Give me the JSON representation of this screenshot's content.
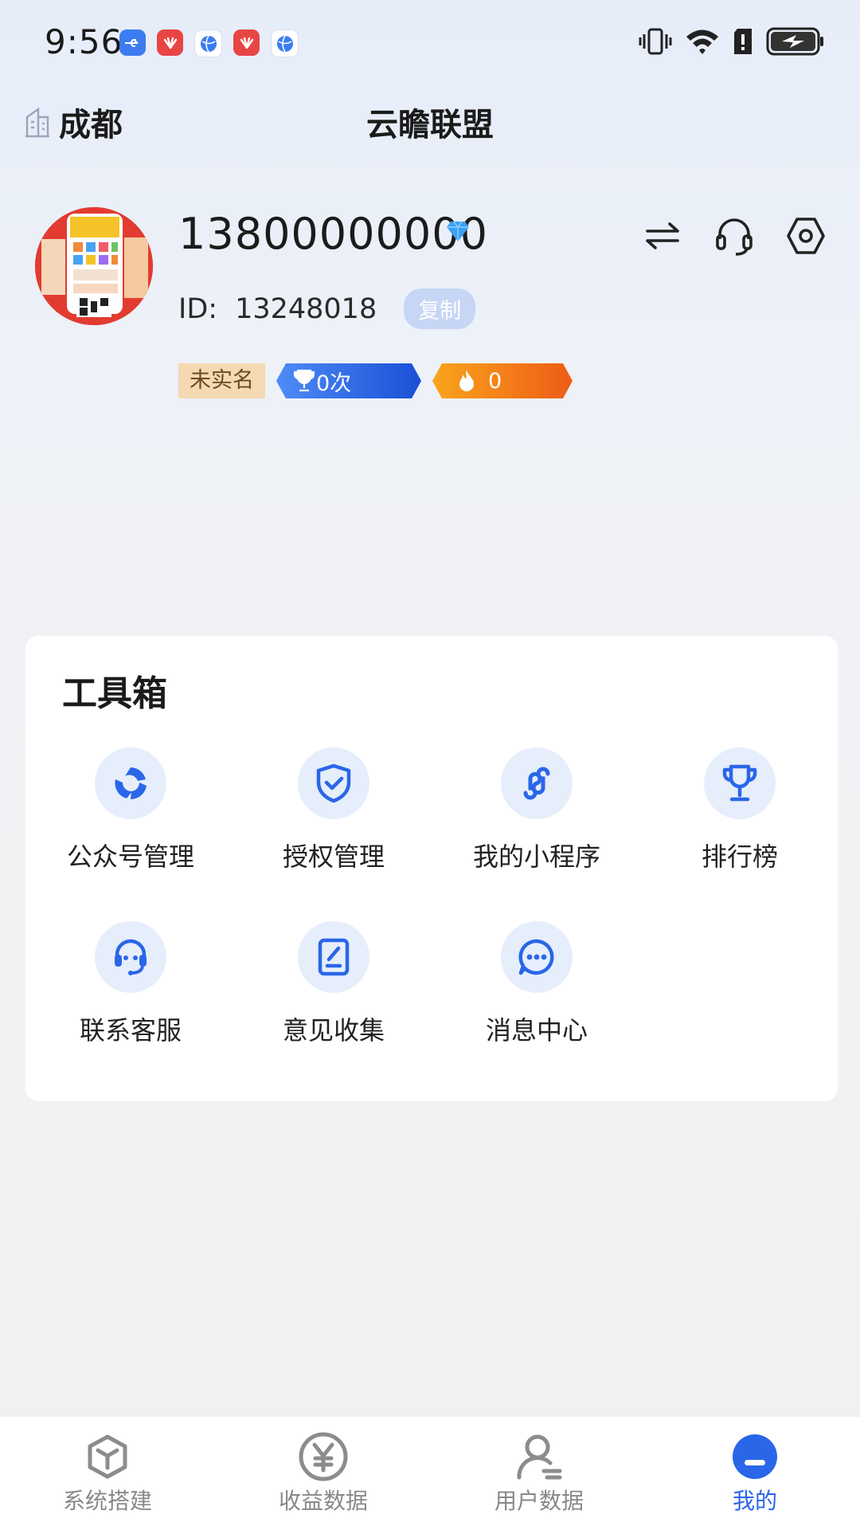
{
  "status_bar": {
    "time": "9:56"
  },
  "header": {
    "city": "成都",
    "title": "云瞻联盟"
  },
  "profile": {
    "phone": "13800000000",
    "id_label": "ID:",
    "id_value": "13248018",
    "copy_label": "复制",
    "verify_badge": "未实名",
    "trophy_badge": "0次",
    "fire_badge": "0"
  },
  "toolbox": {
    "title": "工具箱",
    "items": [
      {
        "label": "公众号管理",
        "icon": "official-account-icon"
      },
      {
        "label": "授权管理",
        "icon": "shield-check-icon"
      },
      {
        "label": "我的小程序",
        "icon": "mini-program-icon"
      },
      {
        "label": "排行榜",
        "icon": "trophy-icon"
      },
      {
        "label": "联系客服",
        "icon": "customer-service-icon"
      },
      {
        "label": "意见收集",
        "icon": "feedback-icon"
      },
      {
        "label": "消息中心",
        "icon": "message-icon"
      }
    ]
  },
  "tab_bar": {
    "items": [
      {
        "label": "系统搭建",
        "icon": "cube-icon"
      },
      {
        "label": "收益数据",
        "icon": "yuan-icon"
      },
      {
        "label": "用户数据",
        "icon": "user-icon"
      },
      {
        "label": "我的",
        "icon": "me-icon"
      }
    ],
    "active_index": 3
  },
  "colors": {
    "accent": "#2a66e8",
    "tool_icon": "#2a66e8",
    "tool_bg": "#e6eefc"
  }
}
